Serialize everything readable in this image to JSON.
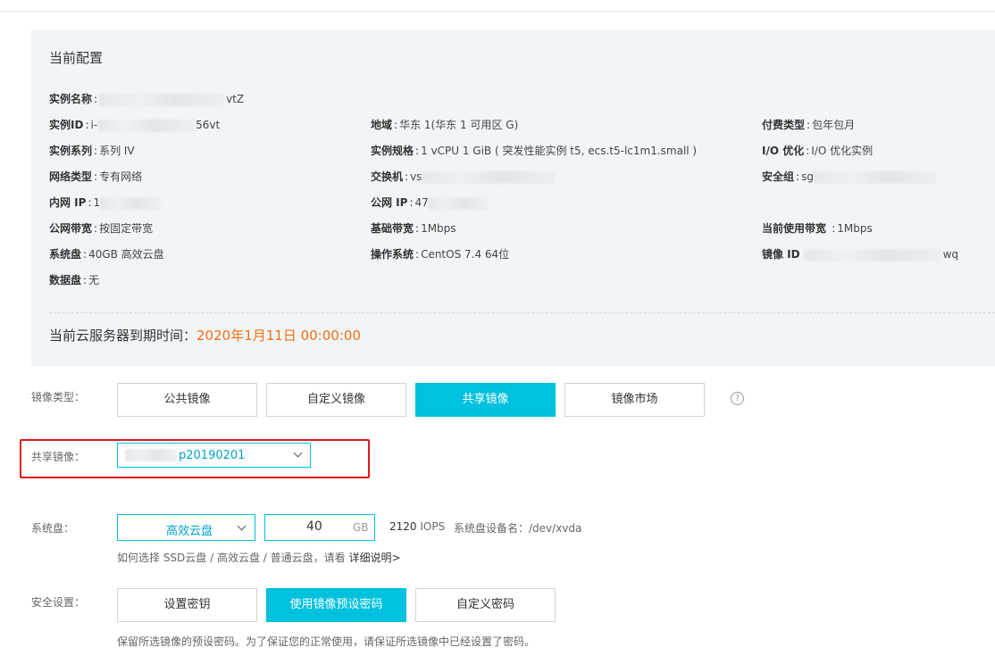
{
  "config": {
    "title": "当前配置",
    "rows": [
      [
        {
          "label": "实例名称",
          "value": "vtZ"
        }
      ],
      [
        {
          "label": "实例ID",
          "value_prefix": "i-",
          "value": "56vt"
        },
        {
          "label": "地域",
          "value": "华东 1(华东 1 可用区 G)"
        },
        {
          "label": "付费类型",
          "value": "包年包月"
        }
      ],
      [
        {
          "label": "实例系列",
          "value": "系列 IV"
        },
        {
          "label": "实例规格",
          "value": "1 vCPU 1 GiB ( 突发性能实例 t5, ecs.t5-lc1m1.small )"
        },
        {
          "label": "I/O 优化",
          "value": "I/O 优化实例"
        }
      ],
      [
        {
          "label": "网络类型",
          "value": "专有网络"
        },
        {
          "label": "交换机",
          "value": "vs"
        },
        {
          "label": "安全组",
          "value": "sg"
        }
      ],
      [
        {
          "label": "内网 IP",
          "value": "1"
        },
        {
          "label": "公网 IP",
          "value": "47"
        }
      ],
      [
        {
          "label": "公网带宽",
          "value": "按固定带宽"
        },
        {
          "label": "基础带宽",
          "value": "1Mbps"
        },
        {
          "label": "当前使用带宽 ",
          "value": "1Mbps"
        }
      ],
      [
        {
          "label": "系统盘",
          "value": "40GB 高效云盘"
        },
        {
          "label": "操作系统",
          "value": "CentOS 7.4 64位"
        },
        {
          "label": "镜像 ID",
          "value": "wq"
        }
      ],
      [
        {
          "label": "数据盘",
          "value": "无"
        }
      ]
    ],
    "expiry_label": "当前云服务器到期时间：",
    "expiry_date": "2020年1月11日 00:00:00"
  },
  "image_type": {
    "label": "镜像类型：",
    "options": [
      "公共镜像",
      "自定义镜像",
      "共享镜像",
      "镜像市场"
    ],
    "selected": "共享镜像",
    "help_icon": "question-circle-icon"
  },
  "shared_image": {
    "label": "共享镜像：",
    "value": "p20190201"
  },
  "system_disk": {
    "label": "系统盘：",
    "type": "高效云盘",
    "size": "40",
    "unit": "GB",
    "iops_value": "2120",
    "iops_unit": "IOPS",
    "device_label": "系统盘设备名：/dev/xvda",
    "hint_prefix": "如何选择 SSD云盘 / 高效云盘 / 普通云盘，请看 ",
    "hint_link": "详细说明>"
  },
  "security": {
    "label": "安全设置：",
    "options": [
      "设置密钥",
      "使用镜像预设密码",
      "自定义密码"
    ],
    "selected": "使用镜像预设密码",
    "hint": "保留所选镜像的预设密码。为了保证您的正常使用，请保证所选镜像中已经设置了密码。"
  },
  "colors": {
    "accent": "#00c1de",
    "expiry": "#f56d14",
    "highlight_box": "#e0181a",
    "panel_bg": "#f0f6f8"
  }
}
